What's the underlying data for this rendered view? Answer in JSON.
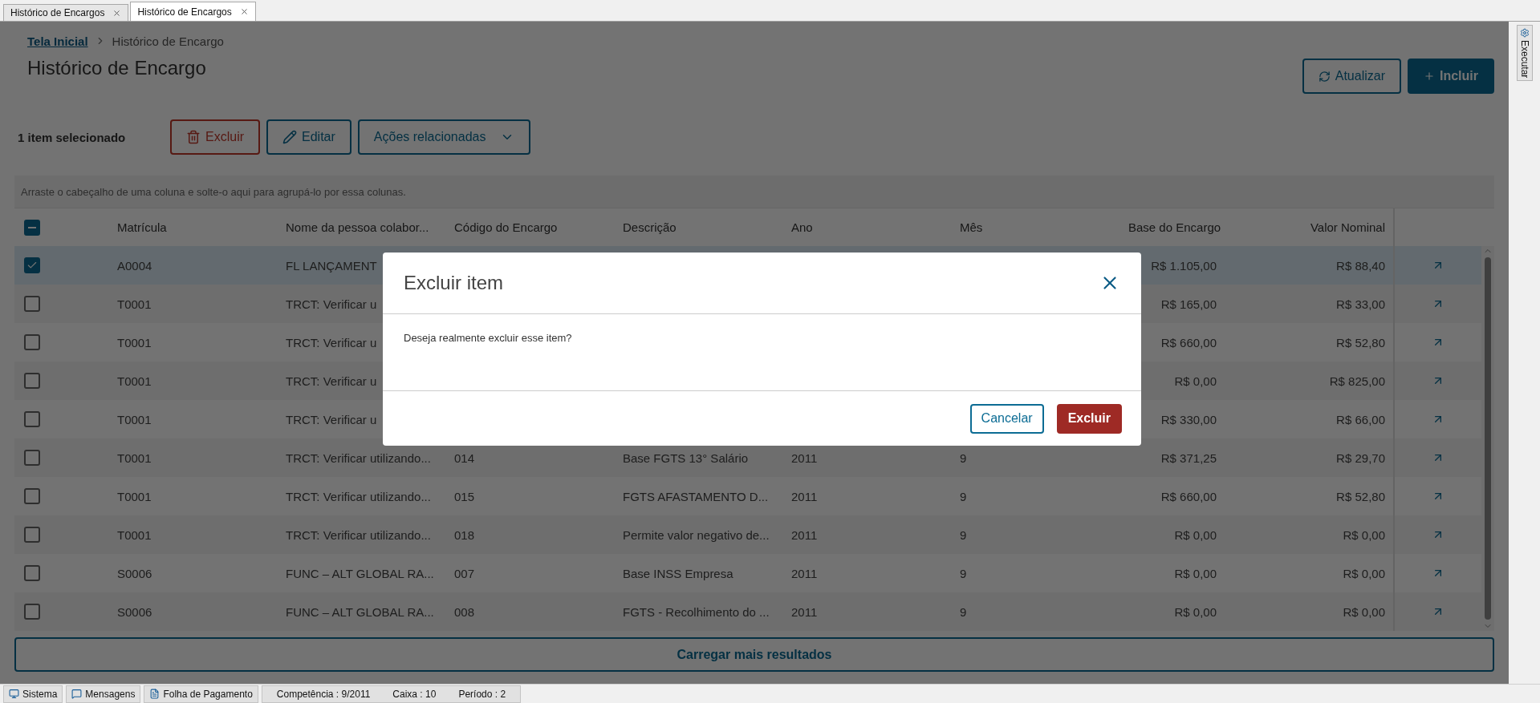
{
  "tabs": [
    {
      "label": "Histórico de Encargos",
      "selected": false
    },
    {
      "label": "Histórico de Encargos",
      "selected": true
    }
  ],
  "side_tab": {
    "label": "Executar"
  },
  "breadcrumb": [
    {
      "label": "Tela Inicial",
      "kind": "link"
    },
    {
      "label": "Histórico de Encargo",
      "kind": "current"
    }
  ],
  "title": "Histórico de Encargo",
  "header_actions": [
    {
      "label": "Atualizar",
      "kind": "secondary"
    },
    {
      "label": "Incluir",
      "kind": "primary"
    }
  ],
  "selection_info": "1 item selecionado",
  "bulk_actions": [
    {
      "label": "Excluir",
      "kind": "danger"
    },
    {
      "label": "Editar",
      "kind": "edit"
    },
    {
      "label": "Ações relacionadas",
      "kind": "dropdown"
    }
  ],
  "table": {
    "group_hint": "Arraste o cabeçalho de uma coluna e solte-o aqui para agrupá-lo por essa colunas.",
    "select_all": {
      "indeterminate": true
    },
    "columns": [
      {
        "label": "Matrícula",
        "kind": "text"
      },
      {
        "label": "Nome da pessoa colabor...",
        "kind": "text"
      },
      {
        "label": "Código do Encargo",
        "kind": "text"
      },
      {
        "label": "Descrição",
        "kind": "text"
      },
      {
        "label": "Ano",
        "kind": "text"
      },
      {
        "label": "Mês",
        "kind": "text"
      },
      {
        "label": "Base do Encargo",
        "kind": "money"
      },
      {
        "label": "Valor Nominal",
        "kind": "money"
      }
    ],
    "rows": [
      {
        "selected": true,
        "cells": [
          "A0004",
          "FL LANÇAMENT",
          null,
          null,
          null,
          null,
          "R$ 1.105,00",
          "R$ 88,40"
        ]
      },
      {
        "selected": false,
        "cells": [
          "T0001",
          "TRCT: Verificar u",
          null,
          null,
          null,
          null,
          "R$ 165,00",
          "R$ 33,00"
        ]
      },
      {
        "selected": false,
        "cells": [
          "T0001",
          "TRCT: Verificar u",
          null,
          null,
          null,
          null,
          "R$ 660,00",
          "R$ 52,80"
        ]
      },
      {
        "selected": false,
        "cells": [
          "T0001",
          "TRCT: Verificar u",
          null,
          null,
          null,
          null,
          "R$ 0,00",
          "R$ 825,00"
        ]
      },
      {
        "selected": false,
        "cells": [
          "T0001",
          "TRCT: Verificar u",
          null,
          null,
          null,
          null,
          "R$ 330,00",
          "R$ 66,00"
        ]
      },
      {
        "selected": false,
        "cells": [
          "T0001",
          "TRCT: Verificar utilizando...",
          "014",
          "Base FGTS 13° Salário",
          "2011",
          "9",
          "R$ 371,25",
          "R$ 29,70"
        ]
      },
      {
        "selected": false,
        "cells": [
          "T0001",
          "TRCT: Verificar utilizando...",
          "015",
          "FGTS AFASTAMENTO D...",
          "2011",
          "9",
          "R$ 660,00",
          "R$ 52,80"
        ]
      },
      {
        "selected": false,
        "cells": [
          "T0001",
          "TRCT: Verificar utilizando...",
          "018",
          "Permite valor negativo de...",
          "2011",
          "9",
          "R$ 0,00",
          "R$ 0,00"
        ]
      },
      {
        "selected": false,
        "cells": [
          "S0006",
          "FUNC – ALT GLOBAL RA...",
          "007",
          "Base INSS Empresa",
          "2011",
          "9",
          "R$ 0,00",
          "R$ 0,00"
        ]
      },
      {
        "selected": false,
        "cells": [
          "S0006",
          "FUNC – ALT GLOBAL RA...",
          "008",
          "FGTS - Recolhimento do ...",
          "2011",
          "9",
          "R$ 0,00",
          "R$ 0,00"
        ]
      }
    ]
  },
  "load_more": "Carregar mais resultados",
  "dialog": {
    "title": "Excluir item",
    "message": "Deseja realmente excluir esse item?",
    "buttons": [
      {
        "label": "Cancelar",
        "kind": "secondary"
      },
      {
        "label": "Excluir",
        "kind": "danger"
      }
    ]
  },
  "status_bar": [
    {
      "label": "Sistema",
      "kind": "button"
    },
    {
      "label": "Mensagens",
      "kind": "button"
    },
    {
      "label": "Folha de Pagamento",
      "kind": "button"
    },
    {
      "label": "Competência : 9/2011",
      "kind": "info"
    },
    {
      "label": "Caixa : 10",
      "kind": "info"
    },
    {
      "label": "Período : 2",
      "kind": "info"
    }
  ]
}
